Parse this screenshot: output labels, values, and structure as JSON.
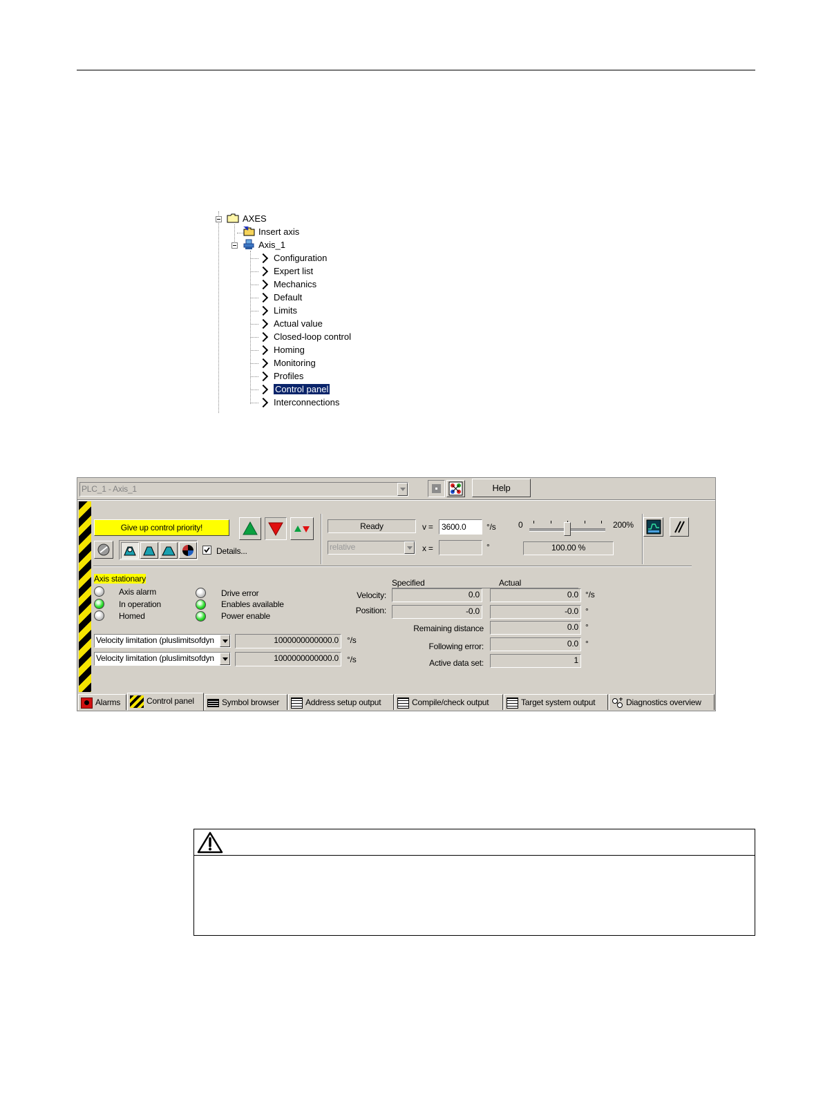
{
  "tree": {
    "root": "AXES",
    "insert": "Insert axis",
    "axis": "Axis_1",
    "items": [
      "Configuration",
      "Expert list",
      "Mechanics",
      "Default",
      "Limits",
      "Actual value",
      "Closed-loop control",
      "Homing",
      "Monitoring",
      "Profiles",
      "Control panel",
      "Interconnections"
    ],
    "selected": "Control panel"
  },
  "panel": {
    "axis_select": "PLC_1 - Axis_1",
    "help_label": "Help",
    "give_up_label": "Give up control priority!",
    "details_label": "Details...",
    "details_checked": true,
    "status": "Ready",
    "v_label": "v =",
    "v_value": "3600.0",
    "v_unit": "°/s",
    "mode": "relative",
    "x_label": "x =",
    "x_unit": "°",
    "override_min": "0",
    "override_max": "200%",
    "override_value": "100.00 %",
    "override_fraction": 0.5,
    "axis_state": "Axis stationary",
    "lamps": [
      {
        "label": "Axis alarm",
        "on": false
      },
      {
        "label": "In operation",
        "on": true
      },
      {
        "label": "Homed",
        "on": false
      },
      {
        "label": "Drive error",
        "on": false
      },
      {
        "label": "Enables available",
        "on": true
      },
      {
        "label": "Power enable",
        "on": true
      }
    ],
    "limit1_select": "Velocity limitation (pluslimitsofdyn",
    "limit1_value": "1000000000000.0",
    "limit1_unit": "°/s",
    "limit2_select": "Velocity limitation (pluslimitsofdyn",
    "limit2_value": "1000000000000.0",
    "limit2_unit": "°/s",
    "specified_header": "Specified",
    "actual_header": "Actual",
    "velocity_label": "Velocity:",
    "position_label": "Position:",
    "remaining_label": "Remaining distance",
    "following_label": "Following error:",
    "dataset_label": "Active data set:",
    "spec_velocity": "0.0",
    "spec_position": "-0.0",
    "act_velocity": "0.0",
    "act_position": "-0.0",
    "remaining": "0.0",
    "following": "0.0",
    "dataset": "1",
    "vel_unit": "°/s",
    "deg_unit": "°"
  },
  "tabs": [
    "Alarms",
    "Control panel",
    "Symbol browser",
    "Address setup output",
    "Compile/check output",
    "Target system output",
    "Diagnostics overview"
  ],
  "colors": {
    "hazard_yellow": "#f5e400",
    "highlight": "#ffff00",
    "lamp_green": "#30e030",
    "selection": "#0a246a",
    "panel": "#d4d0c8"
  }
}
